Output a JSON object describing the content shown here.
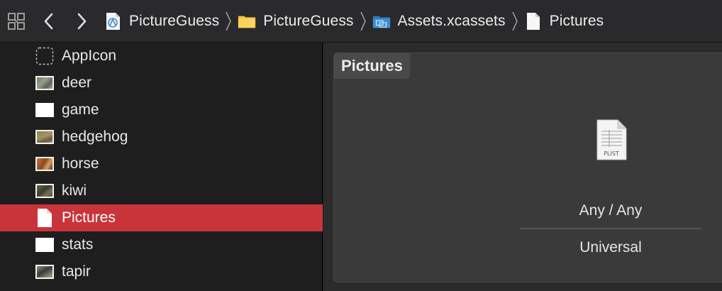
{
  "breadcrumb": {
    "items": [
      {
        "label": "PictureGuess",
        "icon": "xcode-project-icon"
      },
      {
        "label": "PictureGuess",
        "icon": "folder-icon"
      },
      {
        "label": "Assets.xcassets",
        "icon": "asset-catalog-icon"
      },
      {
        "label": "Pictures",
        "icon": "document-icon"
      }
    ]
  },
  "sidebar": {
    "items": [
      {
        "label": "AppIcon",
        "icon": "appicon-placeholder-icon",
        "selected": false
      },
      {
        "label": "deer",
        "icon": "image-thumbnail-icon",
        "selected": false
      },
      {
        "label": "game",
        "icon": "data-asset-icon",
        "selected": false
      },
      {
        "label": "hedgehog",
        "icon": "image-thumbnail-icon",
        "selected": false
      },
      {
        "label": "horse",
        "icon": "image-thumbnail-icon",
        "selected": false
      },
      {
        "label": "kiwi",
        "icon": "image-thumbnail-icon",
        "selected": false
      },
      {
        "label": "Pictures",
        "icon": "document-icon",
        "selected": true
      },
      {
        "label": "stats",
        "icon": "data-asset-icon",
        "selected": false
      },
      {
        "label": "tapir",
        "icon": "image-thumbnail-icon",
        "selected": false
      }
    ]
  },
  "editor": {
    "title": "Pictures",
    "file_badge": "PLIST",
    "appearance": "Any / Any",
    "device": "Universal"
  },
  "colors": {
    "selection": "#c9343a",
    "folder": "#f5c542",
    "asset_catalog": "#3b8fd6"
  }
}
